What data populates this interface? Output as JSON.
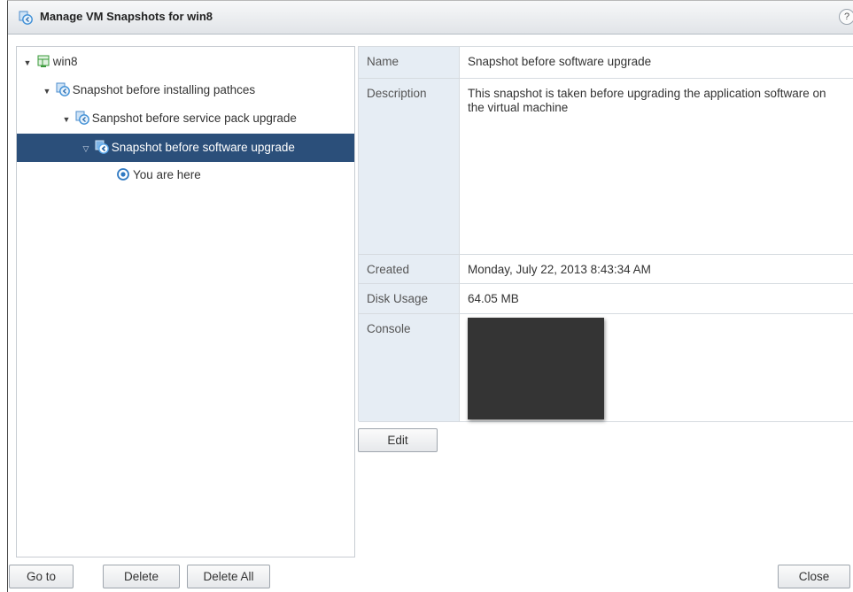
{
  "dialog": {
    "title": "Manage VM Snapshots for win8",
    "help_label": "?"
  },
  "tree": {
    "root": "win8",
    "snapshot1": "Snapshot before installing pathces",
    "snapshot2": "Sanpshot before service pack upgrade",
    "snapshot3": "Snapshot before software upgrade",
    "current": "You are here"
  },
  "details": {
    "name_label": "Name",
    "name_value": "Snapshot before software upgrade",
    "description_label": "Description",
    "description_value": "This snapshot is taken before upgrading the application software on the virtual machine",
    "created_label": "Created",
    "created_value": "Monday, July 22, 2013 8:43:34 AM",
    "disk_usage_label": "Disk Usage",
    "disk_usage_value": "64.05 MB",
    "console_label": "Console"
  },
  "buttons": {
    "edit": "Edit",
    "go_to": "Go to",
    "delete": "Delete",
    "delete_all": "Delete All",
    "close": "Close"
  },
  "colors": {
    "selection": "#2b4f7a",
    "label_bg": "#e6edf4",
    "snapshot_icon": "#3f8fd6"
  }
}
